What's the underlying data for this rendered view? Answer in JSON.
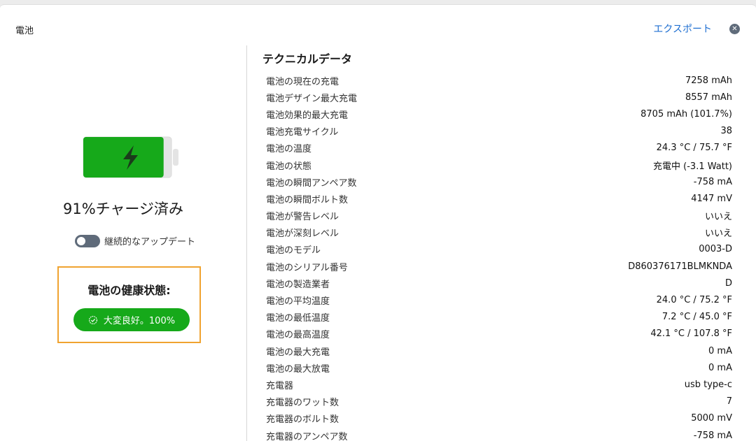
{
  "window": {
    "title": "電池",
    "export_label": "エクスポート",
    "close_icon": "close-icon"
  },
  "left": {
    "charge_percent": 91,
    "charge_text": "91%チャージ済み",
    "battery_icon": "battery-charging-icon",
    "battery_color": "#16a91a",
    "toggle_label": "継続的なアップデート",
    "toggle_on": false,
    "health_title": "電池の健康状態:",
    "health_status": "大変良好。100%",
    "health_icon": "check-circle-icon",
    "health_color": "#16a91a",
    "highlight_color": "#f0a330"
  },
  "tech": {
    "title": "テクニカルデータ",
    "rows": [
      {
        "label": "電池の現在の充電",
        "value": "7258 mAh"
      },
      {
        "label": "電池デザイン最大充電",
        "value": "8557 mAh"
      },
      {
        "label": "電池効果的最大充電",
        "value": "8705 mAh (101.7%)"
      },
      {
        "label": "電池充電サイクル",
        "value": "38"
      },
      {
        "label": "電池の温度",
        "value": "24.3 °C / 75.7 °F"
      },
      {
        "label": "電池の状態",
        "value": "充電中 (-3.1 Watt)"
      },
      {
        "label": "電池の瞬間アンペア数",
        "value": "-758 mA"
      },
      {
        "label": "電池の瞬間ボルト数",
        "value": "4147 mV"
      },
      {
        "label": "電池が警告レベル",
        "value": "いいえ"
      },
      {
        "label": "電池が深刻レベル",
        "value": "いいえ"
      },
      {
        "label": "電池のモデル",
        "value": "0003-D"
      },
      {
        "label": "電池のシリアル番号",
        "value": "D860376171BLMKNDA"
      },
      {
        "label": "電池の製造業者",
        "value": "D"
      },
      {
        "label": "電池の平均温度",
        "value": "24.0 °C / 75.2 °F"
      },
      {
        "label": "電池の最低温度",
        "value": "7.2 °C / 45.0 °F"
      },
      {
        "label": "電池の最高温度",
        "value": "42.1 °C / 107.8 °F"
      },
      {
        "label": "電池の最大充電",
        "value": "0 mA"
      },
      {
        "label": "電池の最大放電",
        "value": "0 mA"
      },
      {
        "label": "充電器",
        "value": "usb type-c"
      },
      {
        "label": "充電器のワット数",
        "value": "7"
      },
      {
        "label": "充電器のボルト数",
        "value": "5000 mV"
      },
      {
        "label": "充電器のアンペア数",
        "value": "-758 mA"
      }
    ]
  }
}
